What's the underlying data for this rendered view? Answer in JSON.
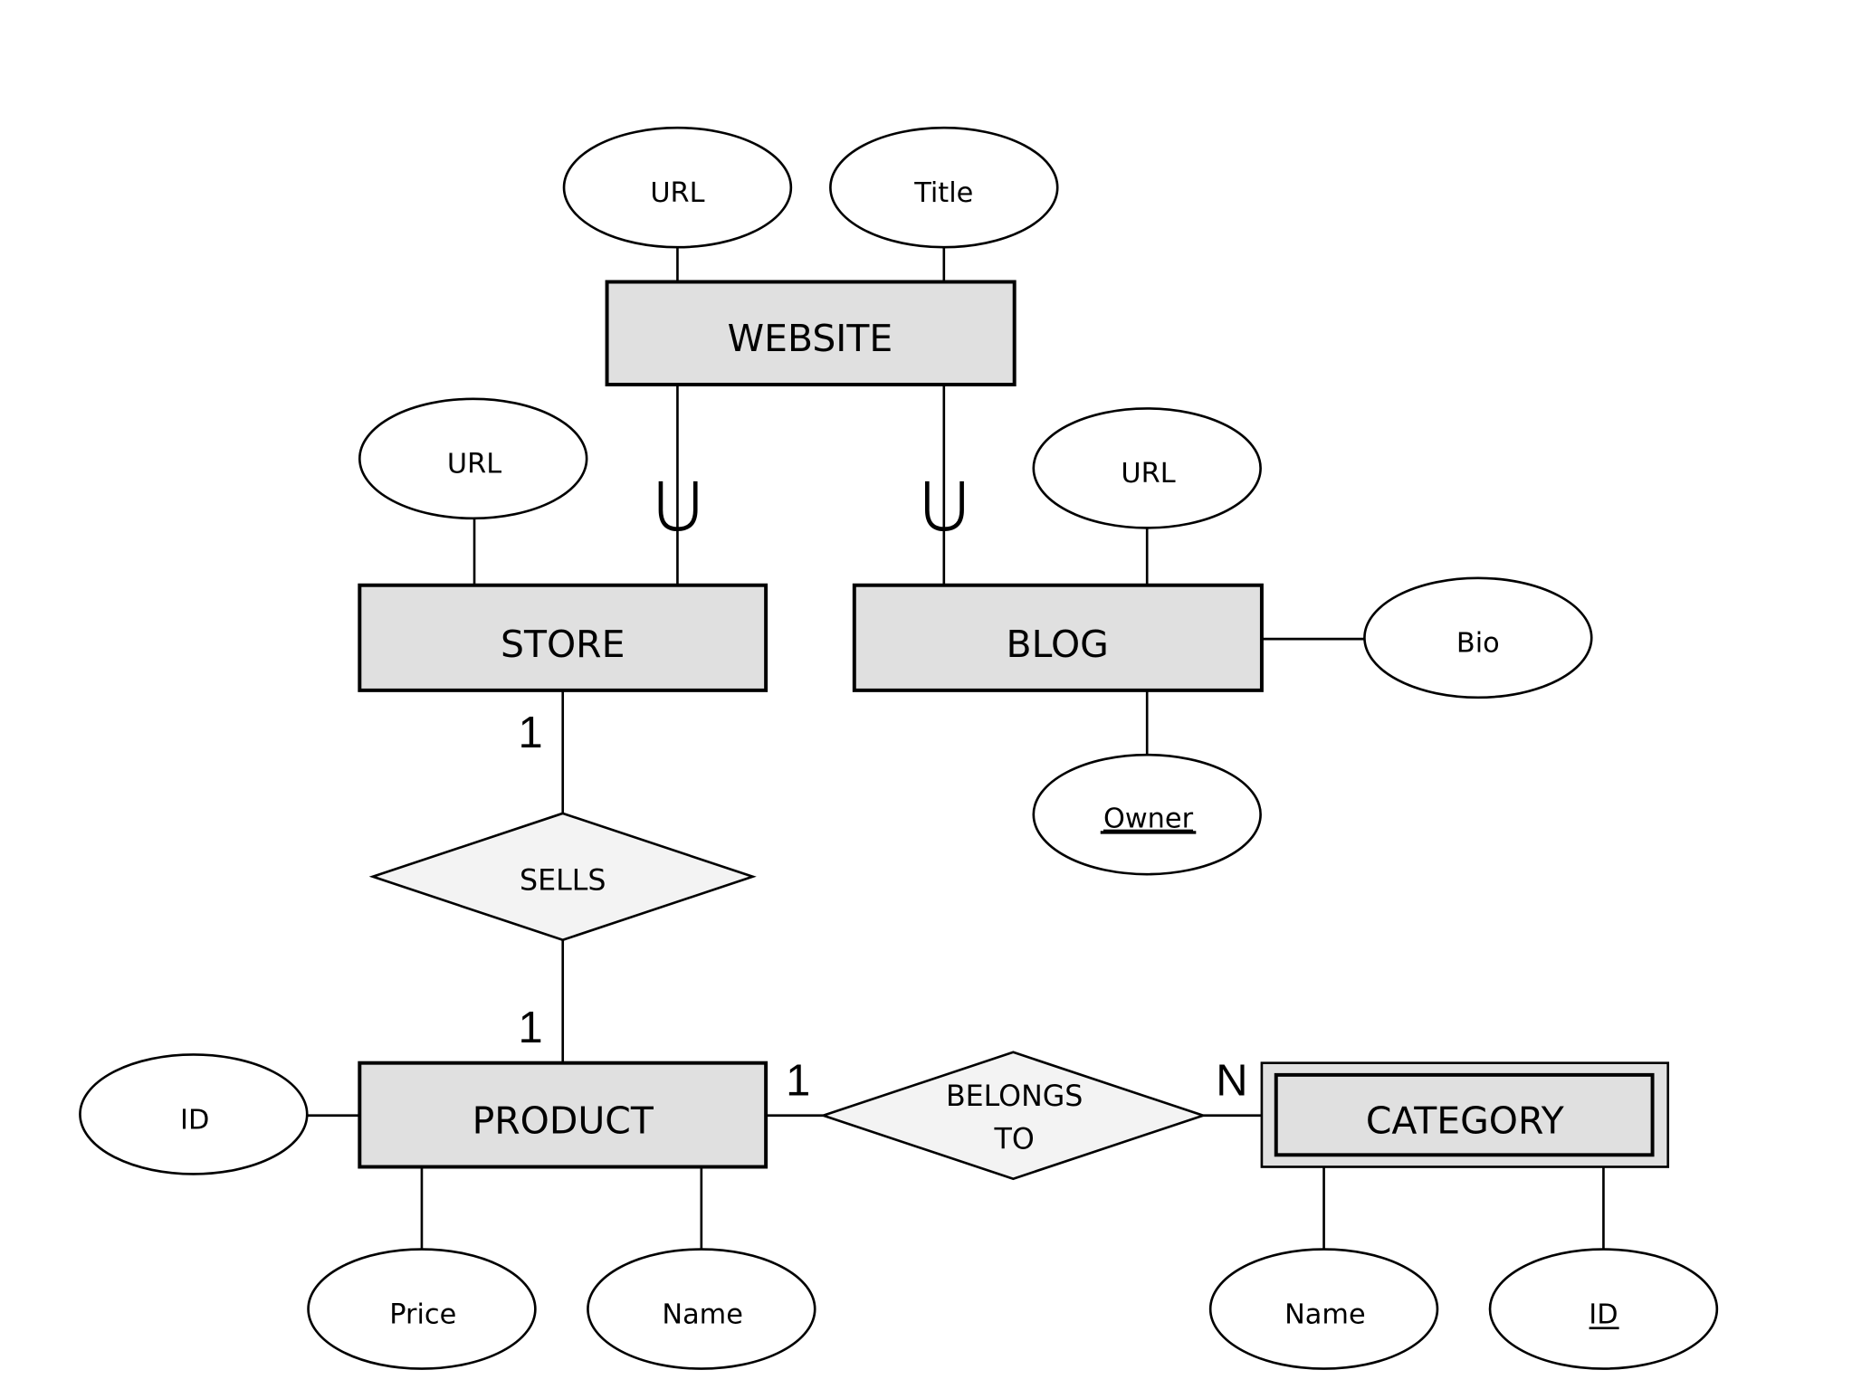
{
  "diagram": {
    "type": "ER diagram",
    "entities": [
      {
        "id": "website",
        "label": "WEBSITE",
        "weak": false
      },
      {
        "id": "store",
        "label": "STORE",
        "weak": false
      },
      {
        "id": "blog",
        "label": "BLOG",
        "weak": false
      },
      {
        "id": "product",
        "label": "PRODUCT",
        "weak": false
      },
      {
        "id": "category",
        "label": "CATEGORY",
        "weak": true
      }
    ],
    "relationships": [
      {
        "id": "sells",
        "label": "SELLS",
        "between": [
          "STORE",
          "PRODUCT"
        ],
        "cardinality": [
          "1",
          "1"
        ]
      },
      {
        "id": "belongs_to",
        "label_line1": "BELONGS",
        "label_line2": "TO",
        "between": [
          "PRODUCT",
          "CATEGORY"
        ],
        "cardinality": [
          "1",
          "N"
        ]
      }
    ],
    "attributes": {
      "website_url": {
        "label": "URL",
        "entity": "WEBSITE",
        "key": false
      },
      "website_title": {
        "label": "Title",
        "entity": "WEBSITE",
        "key": false
      },
      "store_url": {
        "label": "URL",
        "entity": "STORE",
        "key": false
      },
      "blog_url": {
        "label": "URL",
        "entity": "BLOG",
        "key": false
      },
      "blog_bio": {
        "label": "Bio",
        "entity": "BLOG",
        "key": false
      },
      "blog_owner": {
        "label": "Owner",
        "entity": "BLOG",
        "key": true
      },
      "product_id": {
        "label": "ID",
        "entity": "PRODUCT",
        "key": false
      },
      "product_price": {
        "label": "Price",
        "entity": "PRODUCT",
        "key": false
      },
      "product_name": {
        "label": "Name",
        "entity": "PRODUCT",
        "key": false
      },
      "category_name": {
        "label": "Name",
        "entity": "CATEGORY",
        "key": false
      },
      "category_id": {
        "label": "ID",
        "entity": "CATEGORY",
        "key": true
      }
    },
    "specialization": {
      "parent": "WEBSITE",
      "children": [
        "STORE",
        "BLOG"
      ],
      "symbol": "subset-union"
    },
    "cardinality_labels": {
      "store_sells": "1",
      "sells_product": "1",
      "product_belongs": "1",
      "belongs_category": "N"
    },
    "colors": {
      "entity_fill": "#e0e0e0",
      "relationship_fill": "#f3f3f3",
      "attribute_fill": "#ffffff",
      "stroke": "#000000"
    }
  }
}
